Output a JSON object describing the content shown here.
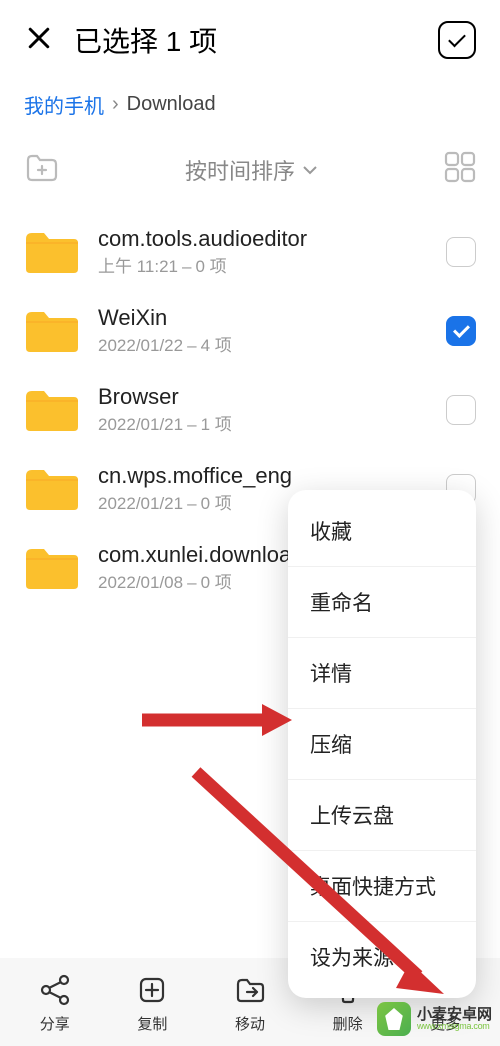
{
  "header": {
    "title": "已选择 1 项"
  },
  "breadcrumb": {
    "root": "我的手机",
    "current": "Download"
  },
  "toolbar": {
    "sort_label": "按时间排序"
  },
  "items": [
    {
      "name": "com.tools.audioeditor",
      "date": "上午 11:21",
      "count": "0 项",
      "checked": false
    },
    {
      "name": "WeiXin",
      "date": "2022/01/22",
      "count": "4 项",
      "checked": true
    },
    {
      "name": "Browser",
      "date": "2022/01/21",
      "count": "1 项",
      "checked": false
    },
    {
      "name": "cn.wps.moffice_eng",
      "date": "2022/01/21",
      "count": "0 项",
      "checked": false
    },
    {
      "name": "com.xunlei.downloadprovider",
      "date": "2022/01/08",
      "count": "0 项",
      "checked": false
    }
  ],
  "popup": {
    "items": [
      "收藏",
      "重命名",
      "详情",
      "压缩",
      "上传云盘",
      "桌面快捷方式",
      "设为来源"
    ]
  },
  "bottom": {
    "share": "分享",
    "copy": "复制",
    "move": "移动",
    "delete": "删除",
    "more": "更多"
  },
  "watermark": {
    "cn": "小麦安卓网",
    "en": "www.xmsigma.com"
  }
}
